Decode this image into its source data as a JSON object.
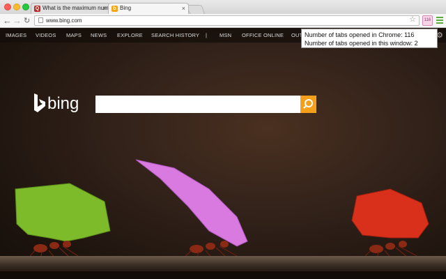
{
  "tabs": [
    {
      "title": "What is the maximum num",
      "favicon": "quora-icon",
      "active": false
    },
    {
      "title": "Bing",
      "favicon": "bing-icon",
      "active": true
    }
  ],
  "toolbar": {
    "url": "www.bing.com",
    "extension_badge": "116"
  },
  "tooltip": {
    "line1": "Number of tabs opened in Chrome: 116",
    "line2": "Number of tabs opened in this window: 2"
  },
  "bing": {
    "nav": [
      "IMAGES",
      "VIDEOS",
      "MAPS",
      "NEWS",
      "EXPLORE",
      "SEARCH HISTORY",
      "|",
      "MSN",
      "OFFICE ONLINE",
      "OUT"
    ],
    "logo_text": "bing",
    "search_value": ""
  },
  "colors": {
    "search_button": "#f5a01a",
    "menu_icon": "#5cab3b"
  }
}
